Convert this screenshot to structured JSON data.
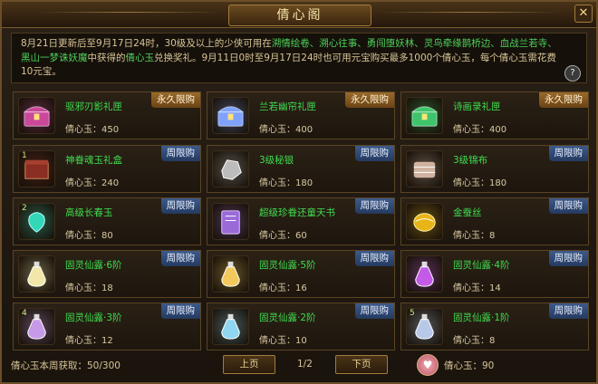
{
  "window": {
    "title": "倩心阁",
    "close": "✕"
  },
  "notice": {
    "p1": "8月21日更新后至9月17日24时，30级及以上的少侠可用在",
    "h1": "溯情绘卷、溯心往事、勇闯堕妖林、灵鸟牵缘鹊桥边、血战兰若寺、黑山一梦诛妖魔",
    "p2": "中获得的",
    "h2": "倩心玉",
    "p3": "兑换奖礼。9月11日0时至9月17日24时也可用元宝购买最多1000个倩心玉，每个倩心玉需花费10元宝。",
    "help": "?"
  },
  "price_label": "倩心玉：",
  "items": [
    {
      "name": "驱邪刃影礼匣",
      "price": "450",
      "tag": "永久限购",
      "tagType": "forever",
      "level": "",
      "color": "#c9489a",
      "glyph": "chest"
    },
    {
      "name": "兰若幽帘礼匣",
      "price": "400",
      "tag": "永久限购",
      "tagType": "forever",
      "level": "",
      "color": "#7fa2ff",
      "glyph": "chest"
    },
    {
      "name": "诗画录礼匣",
      "price": "400",
      "tag": "永久限购",
      "tagType": "forever",
      "level": "",
      "color": "#3fc46b",
      "glyph": "chest"
    },
    {
      "name": "神眷魂玉礼盒",
      "price": "240",
      "tag": "周限购",
      "tagType": "weekly",
      "level": "1",
      "color": "#8a2d22",
      "glyph": "box"
    },
    {
      "name": "3级秘银",
      "price": "180",
      "tag": "周限购",
      "tagType": "weekly",
      "level": "",
      "color": "#bcbcbc",
      "glyph": "ore"
    },
    {
      "name": "3级锦布",
      "price": "180",
      "tag": "周限购",
      "tagType": "weekly",
      "level": "",
      "color": "#cfb3a0",
      "glyph": "cloth"
    },
    {
      "name": "高级长春玉",
      "price": "80",
      "tag": "周限购",
      "tagType": "weekly",
      "level": "2",
      "color": "#34d6b8",
      "glyph": "jade"
    },
    {
      "name": "超级珍眷还童天书",
      "price": "60",
      "tag": "周限购",
      "tagType": "weekly",
      "level": "",
      "color": "#9a6ad8",
      "glyph": "book"
    },
    {
      "name": "金蚕丝",
      "price": "8",
      "tag": "周限购",
      "tagType": "weekly",
      "level": "",
      "color": "#e8b418",
      "glyph": "silk"
    },
    {
      "name": "固灵仙露·6阶",
      "price": "18",
      "tag": "周限购",
      "tagType": "weekly",
      "level": "",
      "color": "#f0e7a8",
      "glyph": "potion"
    },
    {
      "name": "固灵仙露·5阶",
      "price": "16",
      "tag": "周限购",
      "tagType": "weekly",
      "level": "",
      "color": "#f2c95a",
      "glyph": "potion"
    },
    {
      "name": "固灵仙露·4阶",
      "price": "14",
      "tag": "周限购",
      "tagType": "weekly",
      "level": "",
      "color": "#c45ae8",
      "glyph": "potion"
    },
    {
      "name": "固灵仙露·3阶",
      "price": "12",
      "tag": "周限购",
      "tagType": "weekly",
      "level": "4",
      "color": "#c79ae8",
      "glyph": "potion"
    },
    {
      "name": "固灵仙露·2阶",
      "price": "10",
      "tag": "周限购",
      "tagType": "weekly",
      "level": "",
      "color": "#8fd6f0",
      "glyph": "potion"
    },
    {
      "name": "固灵仙露·1阶",
      "price": "8",
      "tag": "周限购",
      "tagType": "weekly",
      "level": "5",
      "color": "#b8c8e8",
      "glyph": "potion"
    }
  ],
  "footer": {
    "weekly_label": "倩心玉本周获取：",
    "weekly_value": "50/300",
    "prev": "上页",
    "page": "1/2",
    "next": "下页",
    "balance_label": "倩心玉：",
    "balance": "90"
  }
}
